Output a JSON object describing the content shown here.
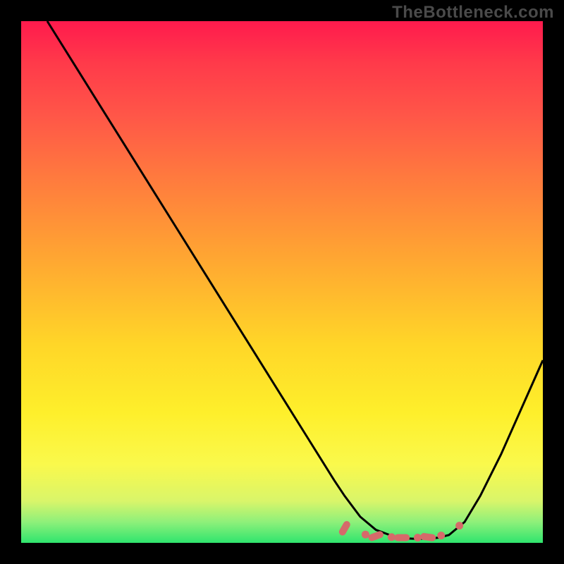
{
  "watermark": "TheBottleneck.com",
  "colors": {
    "background": "#000000",
    "gradient_top": "#ff1a4d",
    "gradient_mid": "#ffd628",
    "gradient_bottom": "#2fe56e",
    "curve": "#000000",
    "marker": "#d66a6a"
  },
  "chart_data": {
    "type": "line",
    "title": "",
    "xlabel": "",
    "ylabel": "",
    "xlim": [
      0,
      100
    ],
    "ylim": [
      0,
      100
    ],
    "series": [
      {
        "name": "bottleneck-curve",
        "x": [
          5,
          10,
          15,
          20,
          25,
          30,
          35,
          40,
          45,
          50,
          55,
          60,
          62,
          65,
          68,
          72,
          75,
          78,
          80,
          82,
          85,
          88,
          92,
          96,
          100
        ],
        "y": [
          100,
          92,
          84,
          76,
          68,
          60,
          52,
          44,
          36,
          28,
          20,
          12,
          9,
          5,
          2.5,
          1,
          0.8,
          0.8,
          1,
          1.5,
          4,
          9,
          17,
          26,
          35
        ]
      }
    ],
    "markers": {
      "name": "optimal-range",
      "points": [
        {
          "x": 62,
          "y": 2.8,
          "shape": "pill",
          "angle": -60
        },
        {
          "x": 66,
          "y": 1.6,
          "shape": "dot"
        },
        {
          "x": 68,
          "y": 1.3,
          "shape": "pill",
          "angle": -20
        },
        {
          "x": 71,
          "y": 1.1,
          "shape": "dot"
        },
        {
          "x": 73,
          "y": 1.0,
          "shape": "pill",
          "angle": 0
        },
        {
          "x": 76,
          "y": 1.0,
          "shape": "dot"
        },
        {
          "x": 78,
          "y": 1.1,
          "shape": "pill",
          "angle": 8
        },
        {
          "x": 80.5,
          "y": 1.4,
          "shape": "dot"
        },
        {
          "x": 84,
          "y": 3.3,
          "shape": "dot"
        }
      ]
    }
  }
}
